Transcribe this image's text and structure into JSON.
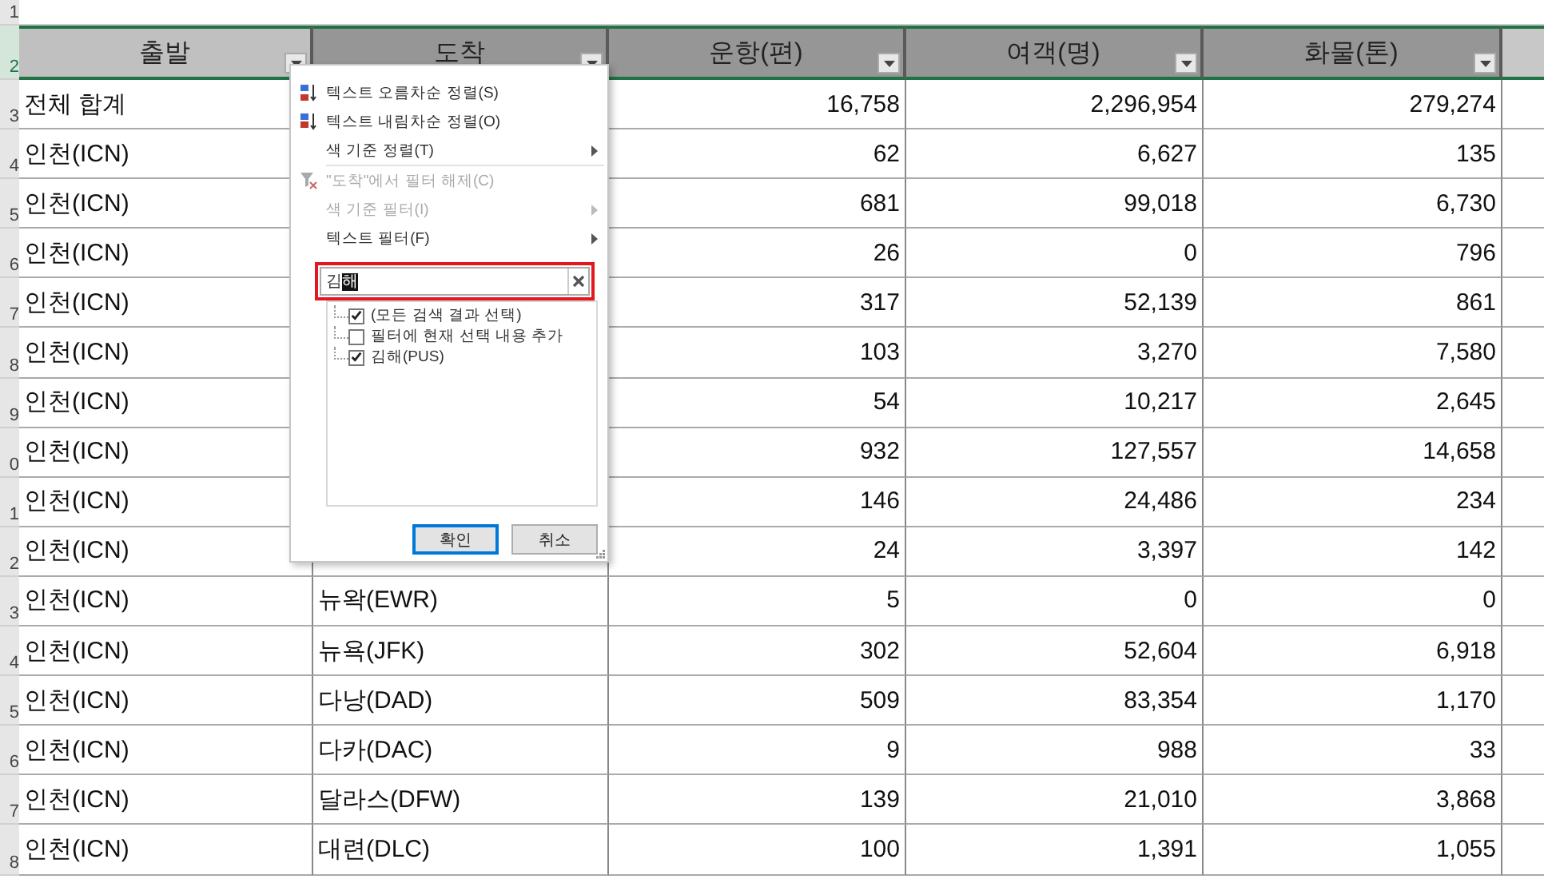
{
  "columns": [
    {
      "label": "출발",
      "selected": true
    },
    {
      "label": "도착",
      "selected": false
    },
    {
      "label": "운항(편)",
      "selected": false
    },
    {
      "label": "여객(명)",
      "selected": false
    },
    {
      "label": "화물(톤)",
      "selected": false
    }
  ],
  "header_row_number": "2",
  "top_row_number": "1",
  "rows": [
    {
      "row_number": "3",
      "origin": "전체 합계",
      "flights": "16,758",
      "passengers": "2,296,954",
      "cargo": "279,274"
    },
    {
      "row_number": "4",
      "origin": "인천(ICN)",
      "flights": "62",
      "passengers": "6,627",
      "cargo": "135"
    },
    {
      "row_number": "5",
      "origin": "인천(ICN)",
      "flights": "681",
      "passengers": "99,018",
      "cargo": "6,730"
    },
    {
      "row_number": "6",
      "origin": "인천(ICN)",
      "flights": "26",
      "passengers": "0",
      "cargo": "796"
    },
    {
      "row_number": "7",
      "origin": "인천(ICN)",
      "flights": "317",
      "passengers": "52,139",
      "cargo": "861"
    },
    {
      "row_number": "8",
      "origin": "인천(ICN)",
      "flights": "103",
      "passengers": "3,270",
      "cargo": "7,580"
    },
    {
      "row_number": "9",
      "origin": "인천(ICN)",
      "flights": "54",
      "passengers": "10,217",
      "cargo": "2,645"
    },
    {
      "row_number": "0",
      "origin": "인천(ICN)",
      "flights": "932",
      "passengers": "127,557",
      "cargo": "14,658"
    },
    {
      "row_number": "1",
      "origin": "인천(ICN)",
      "flights": "146",
      "passengers": "24,486",
      "cargo": "234"
    },
    {
      "row_number": "2",
      "origin": "인천(ICN)",
      "flights": "24",
      "passengers": "3,397",
      "cargo": "142"
    },
    {
      "row_number": "3",
      "origin": "인천(ICN)",
      "destination": "뉴왁(EWR)",
      "flights": "5",
      "passengers": "0",
      "cargo": "0"
    },
    {
      "row_number": "4",
      "origin": "인천(ICN)",
      "destination": "뉴욕(JFK)",
      "flights": "302",
      "passengers": "52,604",
      "cargo": "6,918"
    },
    {
      "row_number": "5",
      "origin": "인천(ICN)",
      "destination": "다낭(DAD)",
      "flights": "509",
      "passengers": "83,354",
      "cargo": "1,170"
    },
    {
      "row_number": "6",
      "origin": "인천(ICN)",
      "destination": "다카(DAC)",
      "flights": "9",
      "passengers": "988",
      "cargo": "33"
    },
    {
      "row_number": "7",
      "origin": "인천(ICN)",
      "destination": "달라스(DFW)",
      "flights": "139",
      "passengers": "21,010",
      "cargo": "3,868"
    },
    {
      "row_number": "8",
      "origin": "인천(ICN)",
      "destination": "대련(DLC)",
      "flights": "100",
      "passengers": "1,391",
      "cargo": "1,055"
    }
  ],
  "filter_menu": {
    "items": [
      {
        "kind": "sort-asc",
        "label": "텍스트 오름차순 정렬(S)",
        "disabled": false,
        "submenu": false
      },
      {
        "kind": "sort-desc",
        "label": "텍스트 내림차순 정렬(O)",
        "disabled": false,
        "submenu": false
      },
      {
        "kind": "plain",
        "label": "색 기준 정렬(T)",
        "disabled": false,
        "submenu": true
      },
      {
        "kind": "clear-filter",
        "label": "\"도착\"에서 필터 해제(C)",
        "disabled": true,
        "submenu": false
      },
      {
        "kind": "plain",
        "label": "색 기준 필터(I)",
        "disabled": true,
        "submenu": true
      },
      {
        "kind": "plain",
        "label": "텍스트 필터(F)",
        "disabled": false,
        "submenu": true
      }
    ],
    "search": {
      "value": "김",
      "selected_value": "해"
    },
    "options": [
      {
        "label": "(모든 검색 결과 선택)",
        "checked": true
      },
      {
        "label": "필터에 현재 선택 내용 추가",
        "checked": false
      },
      {
        "label": "김해(PUS)",
        "checked": true
      }
    ],
    "buttons": [
      {
        "label": "확인",
        "selected": true
      },
      {
        "label": "취소",
        "selected": false
      }
    ]
  }
}
